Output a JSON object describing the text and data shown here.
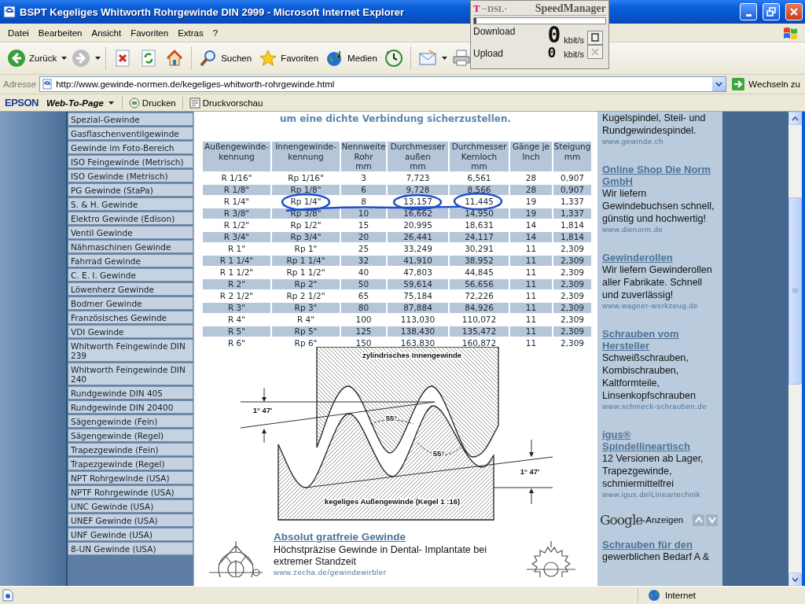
{
  "window": {
    "title": "BSPT Kegeliges Whitworth Rohrgewinde DIN 2999 - Microsoft Internet Explorer"
  },
  "menu": [
    "Datei",
    "Bearbeiten",
    "Ansicht",
    "Favoriten",
    "Extras",
    "?"
  ],
  "toolbar": [
    {
      "kind": "back",
      "label": "Zurück"
    },
    {
      "kind": "forward"
    },
    {
      "kind": "stop"
    },
    {
      "kind": "refresh"
    },
    {
      "kind": "home"
    },
    {
      "kind": "search",
      "label": "Suchen"
    },
    {
      "kind": "favorites",
      "label": "Favoriten"
    },
    {
      "kind": "media",
      "label": "Medien"
    },
    {
      "kind": "history"
    },
    {
      "kind": "mail"
    },
    {
      "kind": "print"
    }
  ],
  "speed_manager": {
    "brand": "T",
    "brand_suffix": "··DSL·",
    "title": "SpeedManager",
    "level": 0.02,
    "download": {
      "label": "Download",
      "value": "0",
      "unit": "kbit/s"
    },
    "upload": {
      "label": "Upload",
      "value": "0",
      "unit": "kbit/s"
    }
  },
  "address": {
    "label": "Adresse",
    "url": "http://www.gewinde-normen.de/kegeliges-whitworth-rohrgewinde.html",
    "go": "Wechseln zu"
  },
  "links_bar": {
    "brand": "EPSON",
    "menu": "Web-To-Page",
    "buttons": [
      "Drucken",
      "Druckvorschau"
    ]
  },
  "sidebar": {
    "items": [
      "Spezial-Gewinde",
      "Gasflaschenventilgewinde",
      "Gewinde im Foto-Bereich",
      "ISO Feingewinde (Metrisch)",
      "ISO Gewinde (Metrisch)",
      "PG Gewinde (StaPa)",
      "S. & H. Gewinde",
      "Elektro Gewinde (Edison)",
      "Ventil Gewinde",
      "Nähmaschinen Gewinde",
      "Fahrrad Gewinde",
      "C. E. I. Gewinde",
      "Löwenherz Gewinde",
      "Bodmer Gewinde",
      "Französisches Gewinde",
      "VDI Gewinde",
      "Whitworth Feingewinde DIN 239",
      "Whitworth Feingewinde DIN 240",
      "Rundgewinde DIN 405",
      "Rundgewinde DIN 20400",
      "Sägengewinde (Fein)",
      "Sägengewinde (Regel)",
      "Trapezgewinde (Fein)",
      "Trapezgewinde (Regel)",
      "NPT Rohrgewinde (USA)",
      "NPTF Rohrgewinde (USA)",
      "UNC Gewinde (USA)",
      "UNEF Gewinde (USA)",
      "UNF Gewinde (USA)",
      "8-UN Gewinde (USA)"
    ]
  },
  "intro": "um eine dichte Verbindung sicherzustellen.",
  "table": {
    "columns": [
      "Außengewinde-\nkennung",
      "Innengewinde-\nkennung",
      "Nennweite\nRohr\nmm",
      "Durchmesser\naußen\nmm",
      "Durchmesser\nKernloch\nmm",
      "Gänge je\nInch",
      "Steigung\nmm"
    ],
    "rows": [
      [
        "R 1/16\"",
        "Rp 1/16\"",
        "3",
        "7,723",
        "6,561",
        "28",
        "0,907"
      ],
      [
        "R 1/8\"",
        "Rp 1/8\"",
        "6",
        "9,728",
        "8,566",
        "28",
        "0,907"
      ],
      [
        "R 1/4\"",
        "Rp 1/4\"",
        "8",
        "13,157",
        "11,445",
        "19",
        "1,337"
      ],
      [
        "R 3/8\"",
        "Rp 3/8\"",
        "10",
        "16,662",
        "14,950",
        "19",
        "1,337"
      ],
      [
        "R 1/2\"",
        "Rp 1/2\"",
        "15",
        "20,995",
        "18,631",
        "14",
        "1,814"
      ],
      [
        "R 3/4\"",
        "Rp 3/4\"",
        "20",
        "26,441",
        "24,117",
        "14",
        "1,814"
      ],
      [
        "R 1\"",
        "Rp 1\"",
        "25",
        "33,249",
        "30,291",
        "11",
        "2,309"
      ],
      [
        "R 1 1/4\"",
        "Rp 1 1/4\"",
        "32",
        "41,910",
        "38,952",
        "11",
        "2,309"
      ],
      [
        "R 1 1/2\"",
        "Rp 1 1/2\"",
        "40",
        "47,803",
        "44,845",
        "11",
        "2,309"
      ],
      [
        "R 2\"",
        "Rp 2\"",
        "50",
        "59,614",
        "56,656",
        "11",
        "2,309"
      ],
      [
        "R 2 1/2\"",
        "Rp 2 1/2\"",
        "65",
        "75,184",
        "72,226",
        "11",
        "2,309"
      ],
      [
        "R 3\"",
        "Rp 3\"",
        "80",
        "87,884",
        "84,926",
        "11",
        "2,309"
      ],
      [
        "R 4\"",
        "R 4\"",
        "100",
        "113,030",
        "110,072",
        "11",
        "2,309"
      ],
      [
        "R 5\"",
        "Rp 5\"",
        "125",
        "138,430",
        "135,472",
        "11",
        "2,309"
      ],
      [
        "R 6\"",
        "Rp 6\"",
        "150",
        "163,830",
        "160,872",
        "11",
        "2,309"
      ]
    ]
  },
  "diagram": {
    "labels": [
      "zylindrisches Innengewinde",
      "1° 47'",
      "55°",
      "55°",
      "1° 47'",
      "kegeliges Außengewinde (Kegel 1 :16)"
    ]
  },
  "bottom_ad": {
    "title": "Absolut gratfreie Gewinde",
    "text": "Höchstpräzise Gewinde in Dental- Implantate bei extremer Standzeit",
    "url": "www.zecha.de/gewindewirbler"
  },
  "ads": [
    {
      "text": "Kugelspindel, Steil- und Rundgewindespindel.",
      "url": "www.gewinde.ch"
    },
    {
      "title": "Online Shop Die Norm GmbH",
      "text": "Wir liefern Gewindebuchsen schnell, günstig und hochwertig!",
      "url": "www.dienorm.de"
    },
    {
      "title": "Gewinderollen",
      "text": "Wir liefern Gewinderollen aller Fabrikate. Schnell und zuverlässig!",
      "url": "www.wagner-werkzeug.de"
    },
    {
      "title": "Schrauben vom Hersteller",
      "text": "Schweißschrauben, Kombischrauben, Kaltformteile, Linsenkopfschrauben",
      "url": "www.schmeck-schrauben.de"
    },
    {
      "title": "igus® Spindellineartisch",
      "text": "12 Versionen ab Lager, Trapezgewinde, schmiermittelfrei",
      "url": "www.igus.de/Lineartechnik"
    }
  ],
  "google": {
    "brand": "Google",
    "label": "-Anzeigen"
  },
  "ads_after": [
    {
      "title": "Schrauben für den",
      "text": "gewerblichen Bedarf A &"
    }
  ],
  "status_bar": {
    "zone": "Internet"
  }
}
